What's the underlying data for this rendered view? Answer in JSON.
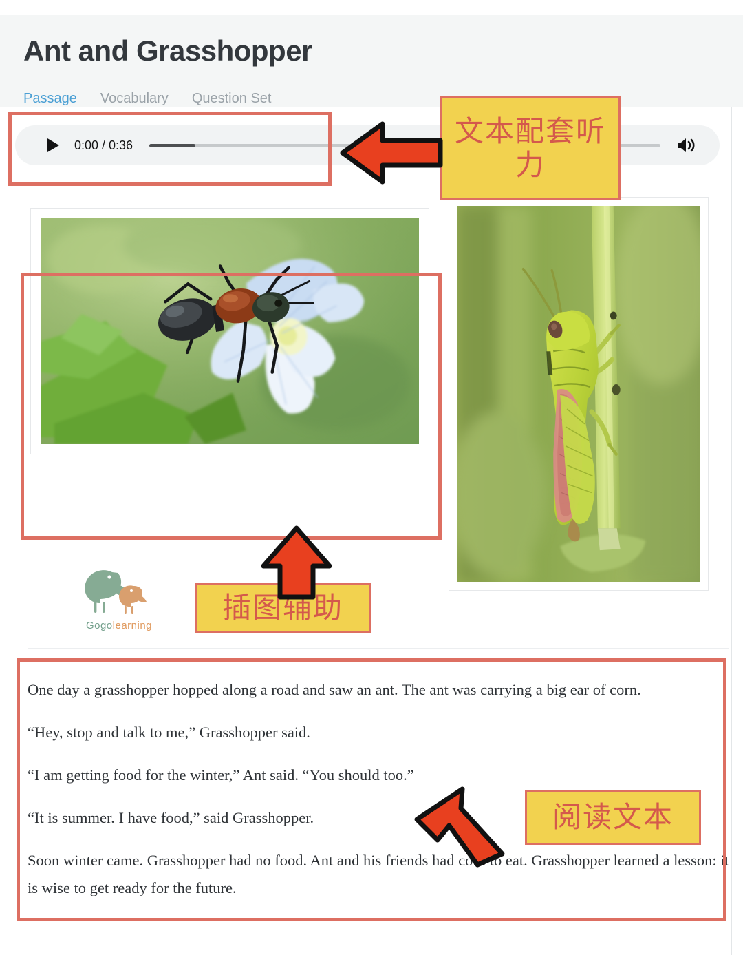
{
  "header": {
    "title": "Ant and Grasshopper",
    "tabs": [
      {
        "label": "Passage",
        "active": true
      },
      {
        "label": "Vocabulary",
        "active": false
      },
      {
        "label": "Question Set",
        "active": false
      }
    ]
  },
  "audio": {
    "play_icon": "play-triangle-icon",
    "time_display": "0:00 / 0:36",
    "current_time": "0:00",
    "duration": "0:36",
    "progress_percent": 9,
    "volume_icon": "volume-speaker-icon"
  },
  "figures": [
    {
      "name": "ant-photo",
      "alt": "Black and red ant standing on a green leaf beside a pale blue flower"
    },
    {
      "name": "grasshopper-photo",
      "alt": "Green grasshopper clinging to a vertical grass stem"
    }
  ],
  "logo": {
    "name": "gogolearning-logo",
    "text_primary": "Gogo",
    "text_secondary": "learning"
  },
  "passage": {
    "paragraphs": [
      "One day a grasshopper hopped along a road and saw an ant. The ant was carrying a big ear of corn.",
      "“Hey, stop and talk to me,” Grasshopper said.",
      "“I am getting food for the winter,” Ant said. “You should too.”",
      "“It is summer. I have food,” said Grasshopper.",
      "Soon winter came. Grasshopper had no food. Ant and his friends had corn to eat. Grasshopper learned a lesson: it is wise to get ready for the future."
    ]
  },
  "annotations": {
    "callouts": [
      {
        "id": "listening",
        "text": "文本配套听力"
      },
      {
        "id": "illustration",
        "text": "插图辅助"
      },
      {
        "id": "reading",
        "text": "阅读文本"
      }
    ],
    "highlight_boxes": [
      {
        "id": "audio-player-box"
      },
      {
        "id": "ant-image-box"
      },
      {
        "id": "passage-text-box"
      }
    ],
    "arrows": [
      {
        "id": "arrow-to-audio",
        "direction": "left"
      },
      {
        "id": "arrow-to-illustration",
        "direction": "up"
      },
      {
        "id": "arrow-to-passage",
        "direction": "up-left"
      }
    ]
  },
  "colors": {
    "accent_blue": "#3f9ad1",
    "annotation_red": "#dd6f62",
    "callout_yellow": "#f2d24f",
    "callout_text": "#d4594c",
    "arrow_red": "#e8401f",
    "header_bg": "#f4f6f6"
  }
}
